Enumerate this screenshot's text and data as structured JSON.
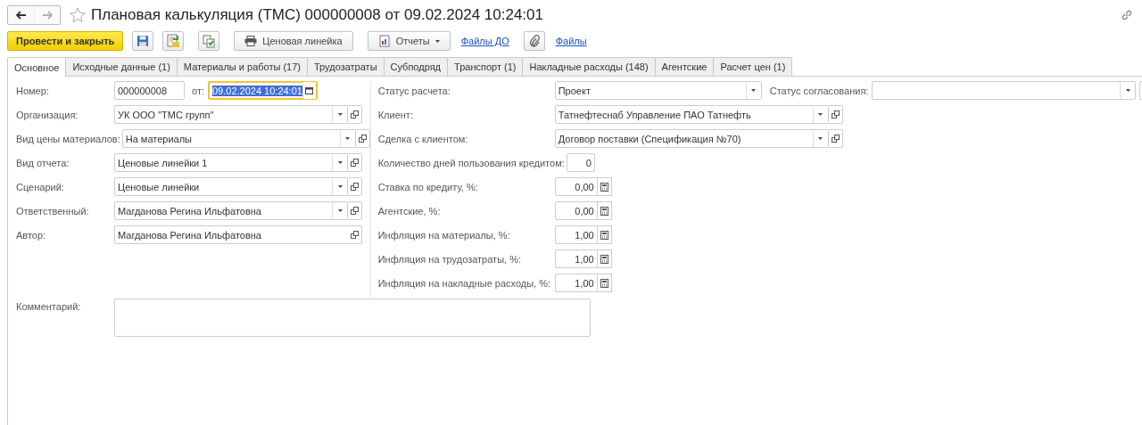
{
  "window": {
    "title": "Плановая калькуляция (ТМС) 000000008 от 09.02.2024 10:24:01",
    "favorite": false
  },
  "navigation": {
    "back_enabled": true,
    "forward_enabled": false
  },
  "toolbar": [
    {
      "kind": "primary",
      "label": "Провести и закрыть"
    },
    {
      "kind": "icon"
    },
    {
      "kind": "icon"
    },
    {
      "kind": "icon"
    },
    {
      "kind": "button",
      "label": "Ценовая линейка"
    },
    {
      "kind": "menu",
      "label": "Отчеты"
    },
    {
      "kind": "link",
      "label": "Файлы ДО"
    },
    {
      "kind": "icon"
    },
    {
      "kind": "link",
      "label": "Файлы"
    }
  ],
  "tabs": [
    {
      "label": "Основное",
      "selected": true
    },
    {
      "label": "Исходные данные (1)",
      "selected": false
    },
    {
      "label": "Материалы и работы (17)",
      "selected": false
    },
    {
      "label": "Трудозатраты",
      "selected": false
    },
    {
      "label": "Субподряд",
      "selected": false
    },
    {
      "label": "Транспорт (1)",
      "selected": false
    },
    {
      "label": "Накладные расходы (148)",
      "selected": false
    },
    {
      "label": "Агентские",
      "selected": false
    },
    {
      "label": "Расчет цен (1)",
      "selected": false
    }
  ],
  "left_fields": [
    {
      "kind": "number-date",
      "label": "Номер:",
      "value": "000000008",
      "date_label": "от:",
      "date": "09.02.2024 10:24:01",
      "focused": true,
      "text_selected": true
    },
    {
      "kind": "select",
      "label": "Организация:",
      "value": "УК ООО \"ТМС групп\"",
      "open_button": true
    },
    {
      "kind": "select",
      "label": "Вид цены материалов:",
      "value": "На материалы",
      "open_button": true
    },
    {
      "kind": "select",
      "label": "Вид отчета:",
      "value": "Ценовые линейки 1",
      "open_button": true
    },
    {
      "kind": "select",
      "label": "Сценарий:",
      "value": "Ценовые линейки",
      "open_button": true
    },
    {
      "kind": "select",
      "label": "Ответственный:",
      "value": "Магданова Регина Ильфатовна",
      "open_button": true
    },
    {
      "kind": "ref",
      "label": "Автор:",
      "value": "Магданова Регина Ильфатовна",
      "open_button": true
    }
  ],
  "right_fields": [
    {
      "kind": "status",
      "label": "Статус расчета:",
      "value": "Проект",
      "second_label": "Статус согласования:"
    },
    {
      "kind": "select",
      "label": "Клиент:",
      "value": "Татнефтеснаб Управление ПАО Татнефть",
      "open_button": true
    },
    {
      "kind": "select",
      "label": "Сделка с клиентом:",
      "value": "Договор поставки (Спецификация №70)",
      "open_button": true
    },
    {
      "kind": "integer",
      "label": "Количество дней пользования кредитом:",
      "value": "0"
    },
    {
      "kind": "decimal",
      "label": "Ставка по кредиту, %:",
      "value": "0,00"
    },
    {
      "kind": "decimal",
      "label": "Агентские, %:",
      "value": "0,00"
    },
    {
      "kind": "decimal",
      "label": "Инфляция на материалы, %:",
      "value": "1,00"
    },
    {
      "kind": "decimal",
      "label": "Инфляция на трудозатраты, %:",
      "value": "1,00"
    },
    {
      "kind": "decimal",
      "label": "Инфляция на накладные расходы, %:",
      "value": "1,00"
    }
  ],
  "comment": {
    "label": "Комментарий:"
  }
}
